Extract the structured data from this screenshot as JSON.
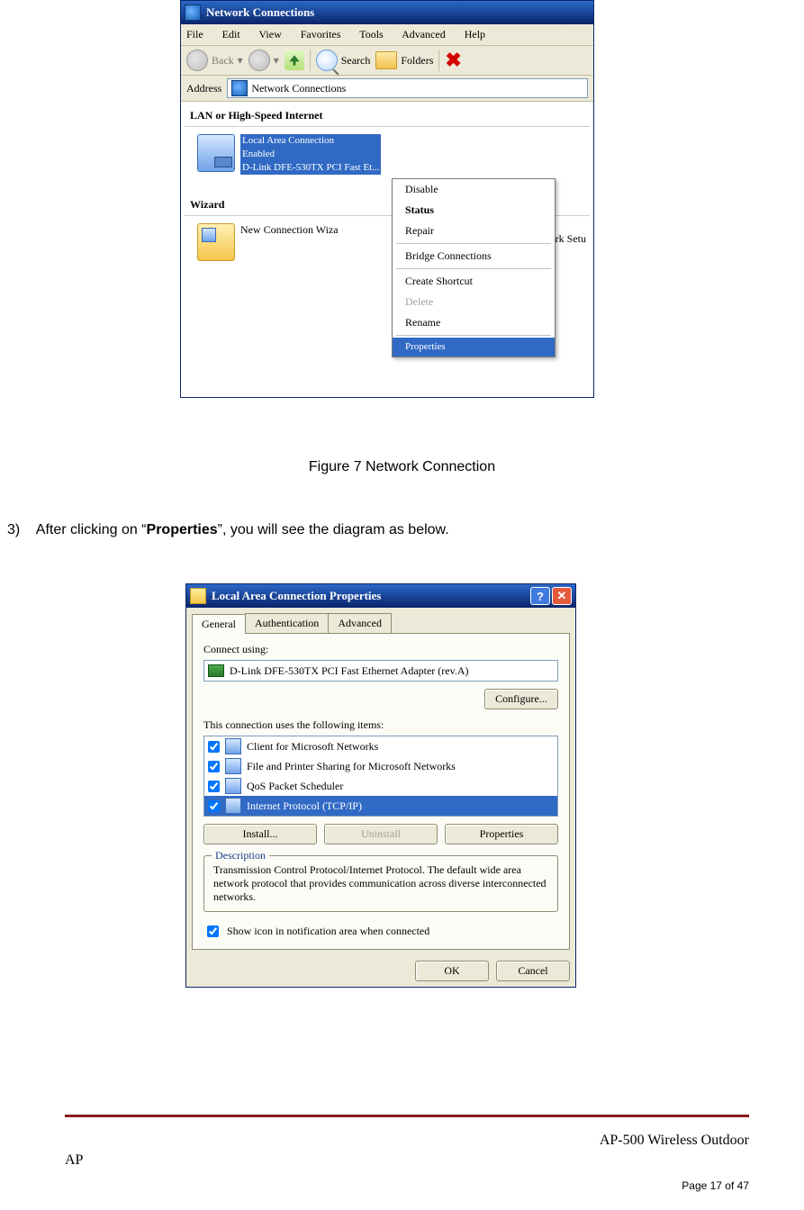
{
  "fig1": {
    "title": "Network Connections",
    "menu": [
      "File",
      "Edit",
      "View",
      "Favorites",
      "Tools",
      "Advanced",
      "Help"
    ],
    "toolbar": {
      "back": "Back",
      "search": "Search",
      "folders": "Folders"
    },
    "address_label": "Address",
    "address_value": "Network Connections",
    "group_lan": "LAN or High-Speed Internet",
    "conn": {
      "name": "Local Area Connection",
      "status": "Enabled",
      "device": "D-Link DFE-530TX PCI Fast Et..."
    },
    "group_wizard": "Wizard",
    "wizard_item": "New Connection Wiza",
    "truncated_right": "work Setu",
    "context": {
      "disable": "Disable",
      "status": "Status",
      "repair": "Repair",
      "bridge": "Bridge Connections",
      "shortcut": "Create Shortcut",
      "delete": "Delete",
      "rename": "Rename",
      "properties": "Properties"
    }
  },
  "caption1": "Figure 7    Network Connection",
  "instruction": {
    "num": "3)",
    "pre": "After clicking on “",
    "bold": "Properties",
    "post": "”, you will see the diagram as below."
  },
  "fig2": {
    "title": "Local Area Connection Properties",
    "tabs": [
      "General",
      "Authentication",
      "Advanced"
    ],
    "connect_using_label": "Connect using:",
    "adapter": "D-Link DFE-530TX PCI Fast Ethernet Adapter (rev.A)",
    "configure": "Configure...",
    "items_label": "This connection uses the following items:",
    "items": [
      {
        "label": "Client for Microsoft Networks",
        "checked": true
      },
      {
        "label": "File and Printer Sharing for Microsoft Networks",
        "checked": true
      },
      {
        "label": "QoS Packet Scheduler",
        "checked": true
      },
      {
        "label": "Internet Protocol (TCP/IP)",
        "checked": true,
        "selected": true
      }
    ],
    "install": "Install...",
    "uninstall": "Uninstall",
    "properties": "Properties",
    "desc_legend": "Description",
    "description": "Transmission Control Protocol/Internet Protocol. The default wide area network protocol that provides communication across diverse interconnected networks.",
    "show_icon": "Show icon in notification area when connected",
    "ok": "OK",
    "cancel": "Cancel"
  },
  "footer": {
    "product": "AP-500    Wireless  Outdoor",
    "ap": "AP",
    "page": "Page 17 of 47"
  }
}
